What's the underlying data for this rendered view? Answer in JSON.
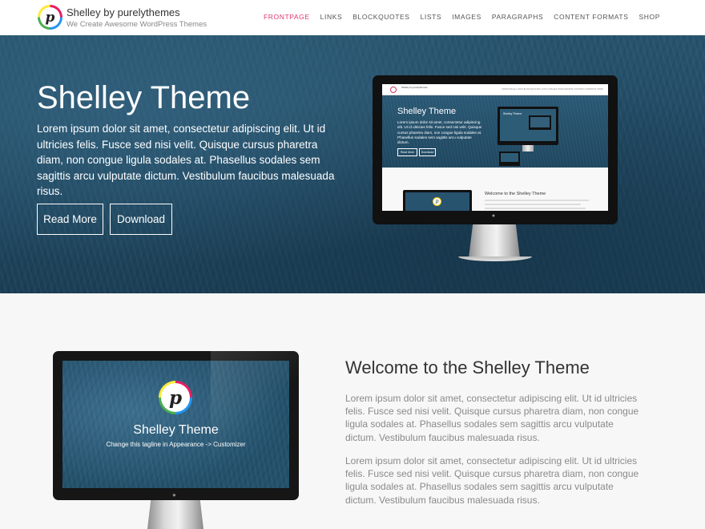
{
  "header": {
    "logo_letter": "p",
    "site_title": "Shelley by purelythemes",
    "tagline": "We Create Awesome WordPress Themes",
    "nav": [
      {
        "label": "FRONTPAGE",
        "active": true
      },
      {
        "label": "LINKS",
        "active": false
      },
      {
        "label": "BLOCKQUOTES",
        "active": false
      },
      {
        "label": "LISTS",
        "active": false
      },
      {
        "label": "IMAGES",
        "active": false
      },
      {
        "label": "PARAGRAPHS",
        "active": false
      },
      {
        "label": "CONTENT FORMATS",
        "active": false
      },
      {
        "label": "SHOP",
        "active": false
      }
    ],
    "active_color": "#e0356f"
  },
  "hero": {
    "title": "Shelley Theme",
    "text": "Lorem ipsum dolor sit amet, consectetur adipiscing elit. Ut id ultricies felis. Fusce sed nisi velit. Quisque cursus pharetra diam, non congue ligula sodales at. Phasellus sodales sem sagittis arcu vulputate dictum. Vestibulum faucibus malesuada risus.",
    "read_more": "Read More",
    "download": "Download",
    "monitor": {
      "site_title": "Shelley by purelythemes",
      "nav": "FRONTPAGE  LINKS  BLOCKQUOTES  LISTS  IMAGES  PARAGRAPHS  CONTENT FORMATS  SHOP",
      "title": "Shelley Theme",
      "text": "Lorem ipsum dolor sit amet, consectetur adipiscing elit. Ut id ultricies felis. Fusce sed nisi velit. Quisque cursus pharetra diam, non congue ligula sodales at. Phasellus sodales sem sagittis arcu vulputate dictum.",
      "read_more": "Read More",
      "download": "Download",
      "inner_title": "Shelley Theme",
      "welcome": "Welcome to the Shelley Theme"
    }
  },
  "welcome": {
    "monitor_logo_letter": "p",
    "monitor_title": "Shelley Theme",
    "monitor_tagline": "Change this tagline in Appearance -> Customizer",
    "title": "Welcome to the Shelley Theme",
    "paragraphs": [
      "Lorem ipsum dolor sit amet, consectetur adipiscing elit. Ut id ultricies felis. Fusce sed nisi velit. Quisque cursus pharetra diam, non congue ligula sodales at. Phasellus sodales sem sagittis arcu vulputate dictum. Vestibulum faucibus malesuada risus.",
      "Lorem ipsum dolor sit amet, consectetur adipiscing elit. Ut id ultricies felis. Fusce sed nisi velit. Quisque cursus pharetra diam, non congue ligula sodales at. Phasellus sodales sem sagittis arcu vulputate dictum. Vestibulum faucibus malesuada risus."
    ]
  }
}
